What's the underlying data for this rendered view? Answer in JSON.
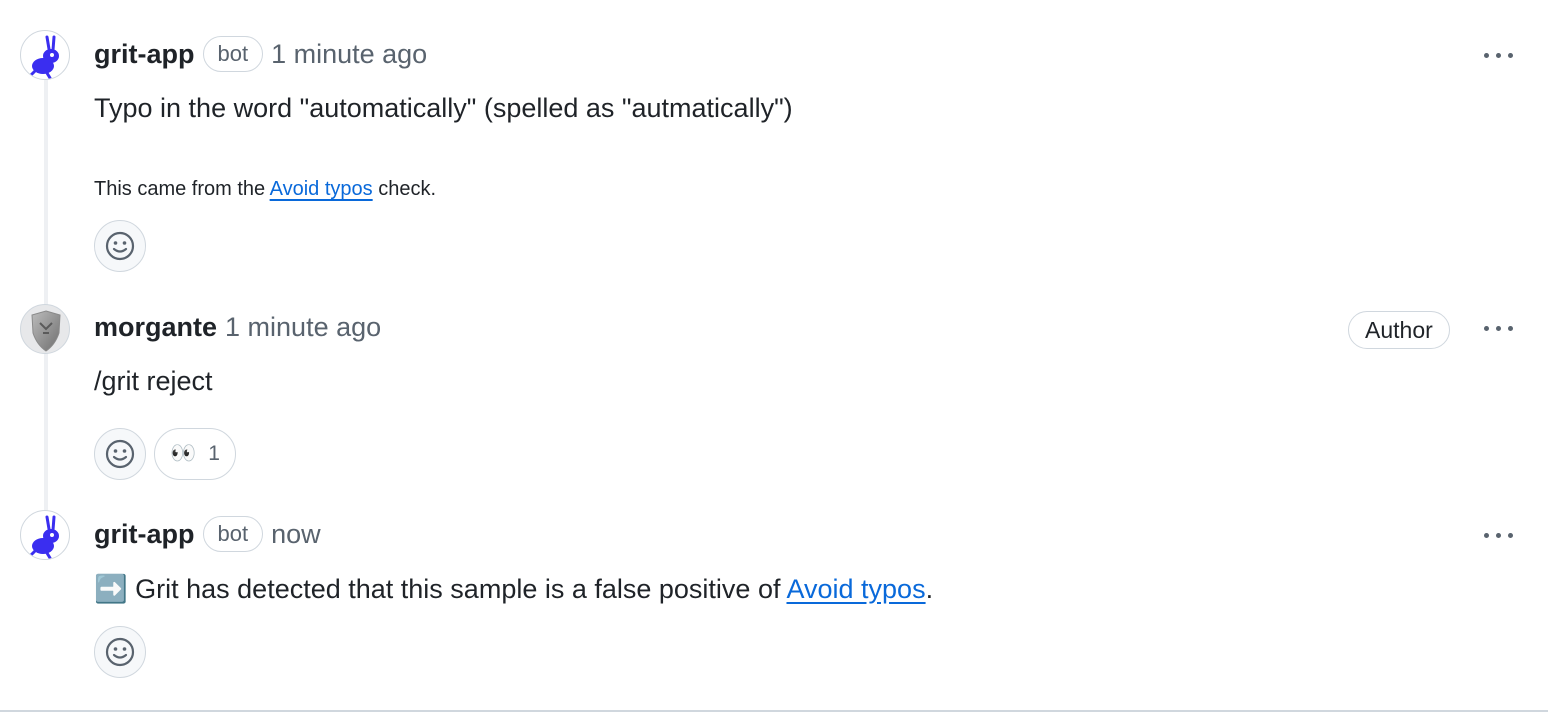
{
  "comments": [
    {
      "author": "grit-app",
      "badge": "bot",
      "timestamp": "1 minute ago",
      "body": "Typo in the word \"automatically\" (spelled as \"autmatically\")",
      "footer_prefix": "This came from the ",
      "footer_link": "Avoid typos",
      "footer_suffix": " check.",
      "avatar_icon": "grit-ant-icon"
    },
    {
      "author": "morgante",
      "timestamp": "1 minute ago",
      "role_badge": "Author",
      "body": "/grit reject",
      "reactions": [
        {
          "emoji": "👀",
          "count": "1"
        }
      ],
      "avatar_icon": "shield-avatar-icon"
    },
    {
      "author": "grit-app",
      "badge": "bot",
      "timestamp": "now",
      "emoji_prefix": "➡️",
      "body_prefix": "Grit has detected that this sample is a false positive of ",
      "body_link": "Avoid typos",
      "body_suffix": ".",
      "avatar_icon": "grit-ant-icon"
    }
  ],
  "colors": {
    "link": "#0969da",
    "muted": "#59636e",
    "border": "#d0d7de",
    "grit_brand": "#3a2ef0"
  }
}
